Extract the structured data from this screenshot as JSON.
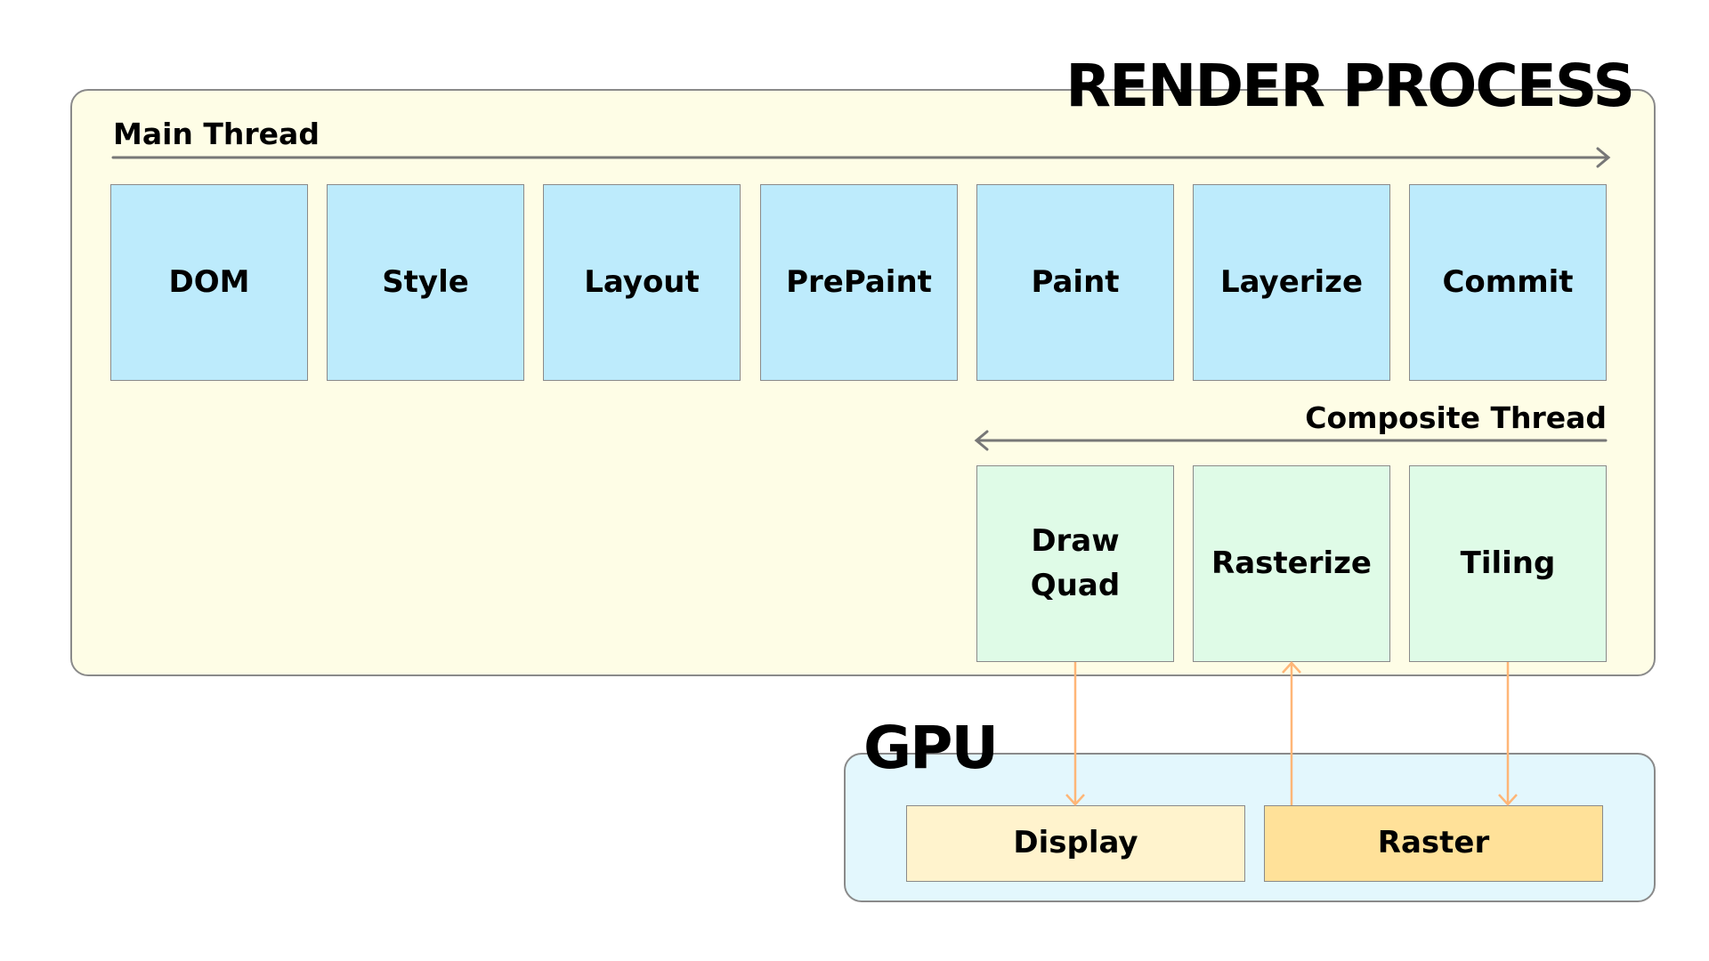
{
  "diagram": {
    "render_process": {
      "title": "RENDER PROCESS",
      "main_thread": {
        "label": "Main Thread",
        "direction": "left-to-right",
        "steps": [
          "DOM",
          "Style",
          "Layout",
          "PrePaint",
          "Paint",
          "Layerize",
          "Commit"
        ]
      },
      "composite_thread": {
        "label": "Composite Thread",
        "direction": "right-to-left",
        "steps": [
          "Draw\nQuad",
          "Rasterize",
          "Tiling"
        ]
      }
    },
    "gpu": {
      "title": "GPU",
      "steps": [
        "Display",
        "Raster"
      ]
    },
    "connections": [
      {
        "from": "Draw Quad",
        "to": "Display"
      },
      {
        "from": "Raster",
        "to": "Rasterize"
      },
      {
        "from": "Tiling",
        "to": "Raster"
      }
    ],
    "colors": {
      "render_bg": "#fefde6",
      "gpu_bg": "#e3f7fd",
      "main_step": "#bdebfc",
      "composite_step": "#dffbe7",
      "display": "#fff3cd",
      "raster": "#ffe199",
      "arrow": "#ffb677",
      "thread_line": "#777777"
    }
  }
}
